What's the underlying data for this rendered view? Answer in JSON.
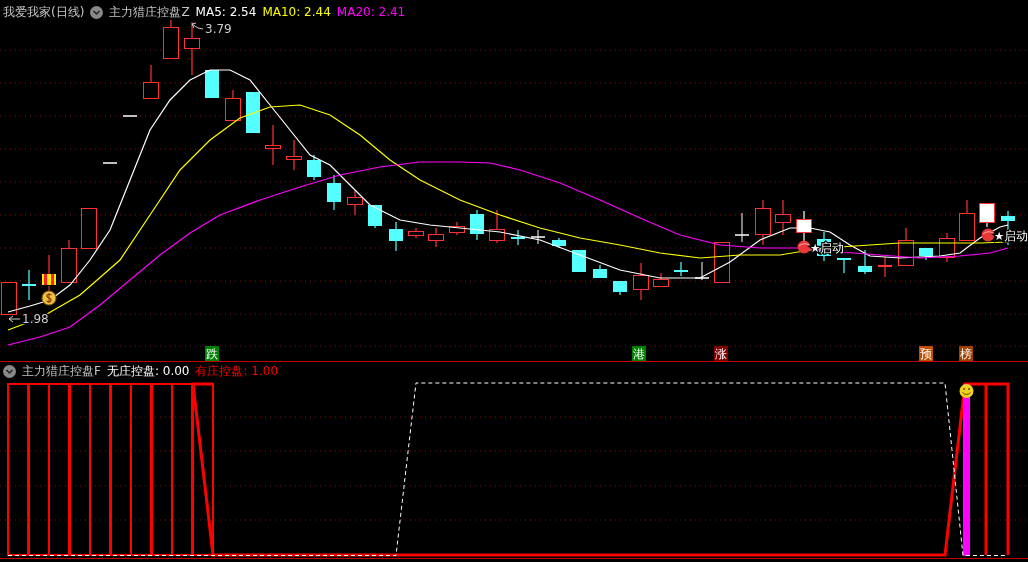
{
  "header": {
    "title": "我爱我家(日线)",
    "indicator": "主力猎庄控盘Z",
    "ma": [
      {
        "label": "MA5: 2.54",
        "color": "#ffffff"
      },
      {
        "label": "MA10: 2.44",
        "color": "#ffff00"
      },
      {
        "label": "MA20: 2.41",
        "color": "#ff00ff"
      }
    ]
  },
  "price_chart": {
    "high_label": "3.79",
    "low_label": "1.98",
    "signals": [
      {
        "text": "★启动"
      },
      {
        "text": "★启动"
      }
    ],
    "markers": [
      {
        "text": "跌",
        "color": "#008000"
      },
      {
        "text": "港",
        "color": "#008000"
      },
      {
        "text": "涨",
        "color": "#800000"
      },
      {
        "text": "预",
        "color": "#c05000"
      },
      {
        "text": "榜",
        "color": "#a04000"
      }
    ]
  },
  "sub_panel": {
    "indicator": "主力猎庄控盘F",
    "values": [
      {
        "label": "无庄控盘: 0.00",
        "color": "#ffffff"
      },
      {
        "label": "有庄控盘: 1.00",
        "color": "#ff0000"
      }
    ]
  }
}
